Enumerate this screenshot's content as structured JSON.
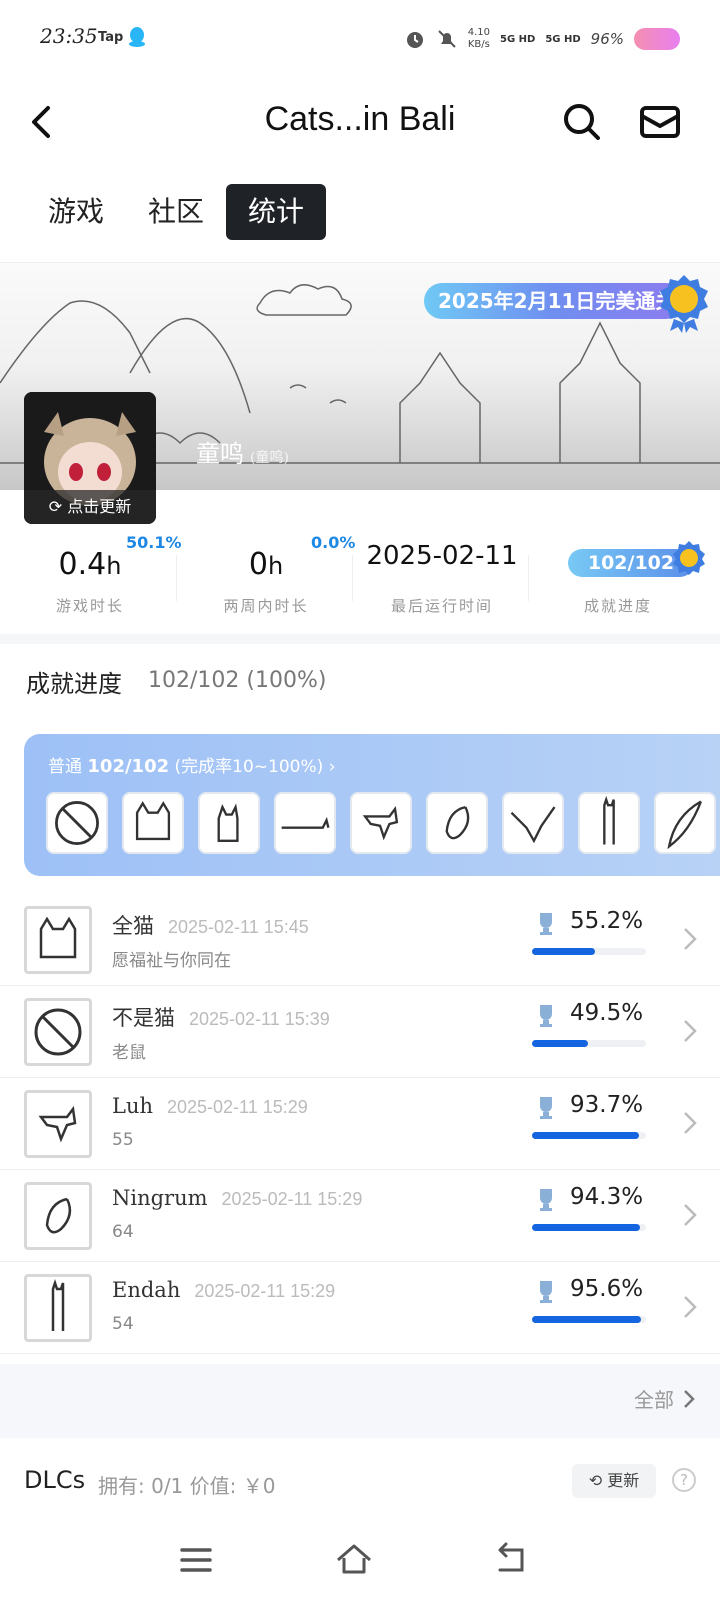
{
  "status_bar": {
    "time": "23:35",
    "app_tag": "Tap",
    "net_speed_value": "4.10",
    "net_speed_unit": "KB/s",
    "network_1": "5G HD",
    "network_2": "5G HD",
    "battery": "96%"
  },
  "header": {
    "title": "Cats...in Bali"
  },
  "tabs": [
    {
      "label": "游戏",
      "active": false
    },
    {
      "label": "社区",
      "active": false
    },
    {
      "label": "统计",
      "active": true
    }
  ],
  "banner": {
    "finish_badge": "2025年2月11日完美通关",
    "username": "童鸣",
    "username_sub": "(童鸣)",
    "avatar_refresh": "点击更新"
  },
  "stats": {
    "playtime_value": "0.4",
    "playtime_unit": "h",
    "playtime_pct": "50.1%",
    "playtime_label": "游戏时长",
    "twoweek_value": "0",
    "twoweek_unit": "h",
    "twoweek_pct": "0.0%",
    "twoweek_label": "两周内时长",
    "lastrun_value": "2025-02-11",
    "lastrun_label": "最后运行时间",
    "achievement_value": "102/102",
    "achievement_label": "成就进度"
  },
  "achievements": {
    "section_title": "成就进度",
    "count": "102/102 (100%)",
    "card_prefix": "普通",
    "card_count": "102/102",
    "card_suffix": "(完成率10~100%)",
    "card_chevron": "›",
    "icon_names": [
      "no-cat-icon",
      "loaf-cat-icon",
      "sitting-cat-icon",
      "lying-cat-icon",
      "dog-cat-icon",
      "curled-cat-icon",
      "stretching-cat-icon",
      "tall-cat-icon",
      "feather-icon"
    ]
  },
  "achievement_list": [
    {
      "name": "全猫",
      "date": "2025-02-11 15:45",
      "desc": "愿福祉与你同在",
      "pct_text": "55.2%",
      "pct": 0.552
    },
    {
      "name": "不是猫",
      "date": "2025-02-11 15:39",
      "desc": "老鼠",
      "pct_text": "49.5%",
      "pct": 0.495
    },
    {
      "name": "Luh",
      "date": "2025-02-11 15:29",
      "desc": "55",
      "pct_text": "93.7%",
      "pct": 0.937
    },
    {
      "name": "Ningrum",
      "date": "2025-02-11 15:29",
      "desc": "64",
      "pct_text": "94.3%",
      "pct": 0.943
    },
    {
      "name": "Endah",
      "date": "2025-02-11 15:29",
      "desc": "54",
      "pct_text": "95.6%",
      "pct": 0.956
    }
  ],
  "all_link": "全部",
  "dlc": {
    "title": "DLCs",
    "info": "拥有: 0/1  价值: ￥0",
    "refresh_label": "更新",
    "help": "?"
  },
  "colors": {
    "accent_blue": "#1565e0",
    "tab_active_bg": "#1f2327",
    "pct_blue": "#1e88e5"
  }
}
